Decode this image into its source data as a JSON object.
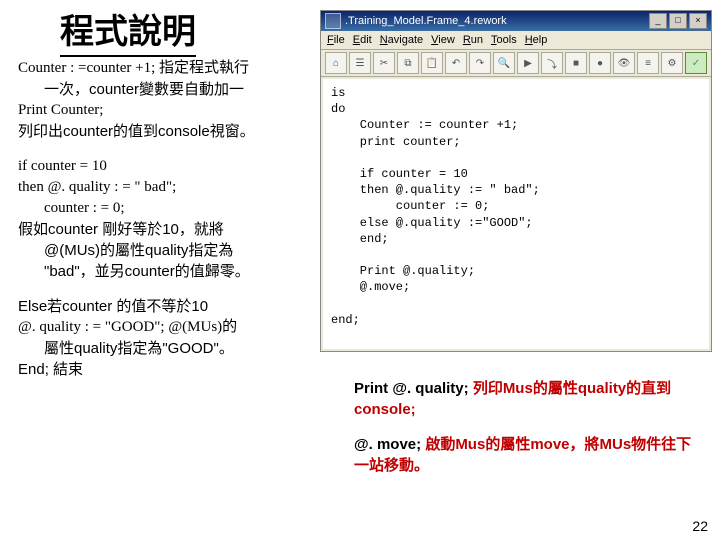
{
  "title": "程式說明",
  "left": {
    "p1_line1": "Counter : =counter +1; 指定程式執行",
    "p1_indent": "一次，counter變數要自動加一",
    "p2_line1": "Print Counter;",
    "p2_line2": "列印出counter的值到console視窗。",
    "p3_line1": "if counter = 10",
    "p3_line2": "then @. quality : = \" bad\";",
    "p3_line3": "counter : = 0;",
    "p4_line1": "假如counter 剛好等於10，就將",
    "p4_line2": "@(MUs)的屬性quality指定為",
    "p4_line3": "\"bad\"，並另counter的值歸零。",
    "p5_line1": "Else若counter 的值不等於10",
    "p5_line2": "@. quality : = \"GOOD\"; @(MUs)的",
    "p5_line3": "屬性quality指定為\"GOOD\"。",
    "p5_line4": "End; 結束"
  },
  "bottom_right": {
    "a_black": "Print @. quality;   ",
    "a_red": "列印Mus的屬性quality的直到console;",
    "b_black": "@. move;    ",
    "b_red": "啟動Mus的屬性move，將MUs物件往下一站移動。"
  },
  "page_number": "22",
  "editor": {
    "window_title": ".Training_Model.Frame_4.rework",
    "btn_min": "_",
    "btn_max": "□",
    "btn_close": "×",
    "menus": [
      "File",
      "Edit",
      "Navigate",
      "View",
      "Run",
      "Tools",
      "Help"
    ],
    "toolbar_icons": [
      "home",
      "open",
      "cut",
      "copy",
      "paste",
      "undo",
      "redo",
      "find",
      "run",
      "step",
      "stop",
      "brk",
      "watch",
      "tree",
      "cfg",
      "ok"
    ],
    "code": "is\ndo\n    Counter := counter +1;\n    print counter;\n\n    if counter = 10\n    then @.quality := \" bad\";\n         counter := 0;\n    else @.quality :=\"GOOD\";\n    end;\n\n    Print @.quality;\n    @.move;\n\nend;"
  }
}
